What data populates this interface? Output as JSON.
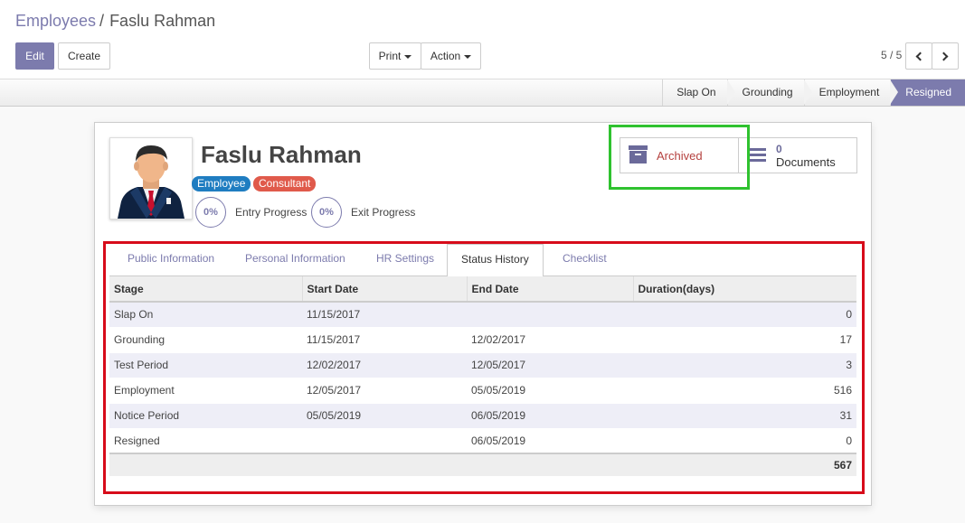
{
  "breadcrumb": {
    "parent": "Employees",
    "separator": "/",
    "current": "Faslu Rahman"
  },
  "toolbar": {
    "edit_label": "Edit",
    "create_label": "Create",
    "print_label": "Print",
    "action_label": "Action"
  },
  "pager": {
    "value": "5 / 5"
  },
  "statusbar": {
    "stages": [
      "Slap On",
      "Grounding",
      "Employment",
      "Resigned"
    ],
    "active_stage": "Resigned"
  },
  "employee": {
    "name": "Faslu Rahman",
    "tags": [
      "Employee",
      "Consultant"
    ],
    "entry_progress": {
      "value": "0%",
      "label": "Entry Progress"
    },
    "exit_progress": {
      "value": "0%",
      "label": "Exit Progress"
    }
  },
  "smart_buttons": {
    "archived_label": "Archived",
    "documents_count": "0",
    "documents_label": "Documents"
  },
  "tabs": [
    "Public Information",
    "Personal Information",
    "HR Settings",
    "Status History",
    "Checklist"
  ],
  "active_tab": "Status History",
  "status_history": {
    "columns": [
      "Stage",
      "Start Date",
      "End Date",
      "Duration(days)"
    ],
    "rows": [
      [
        "Slap On",
        "11/15/2017",
        "",
        "0"
      ],
      [
        "Grounding",
        "11/15/2017",
        "12/02/2017",
        "17"
      ],
      [
        "Test Period",
        "12/02/2017",
        "12/05/2017",
        "3"
      ],
      [
        "Employment",
        "12/05/2017",
        "05/05/2019",
        "516"
      ],
      [
        "Notice Period",
        "05/05/2019",
        "06/05/2019",
        "31"
      ],
      [
        "Resigned",
        "",
        "06/05/2019",
        "0"
      ]
    ],
    "total": "567"
  },
  "colors": {
    "primary": "#7c7bad",
    "highlight_green": "#2fc22f",
    "highlight_red": "#d70c1a",
    "archived_text": "#b5413f"
  }
}
